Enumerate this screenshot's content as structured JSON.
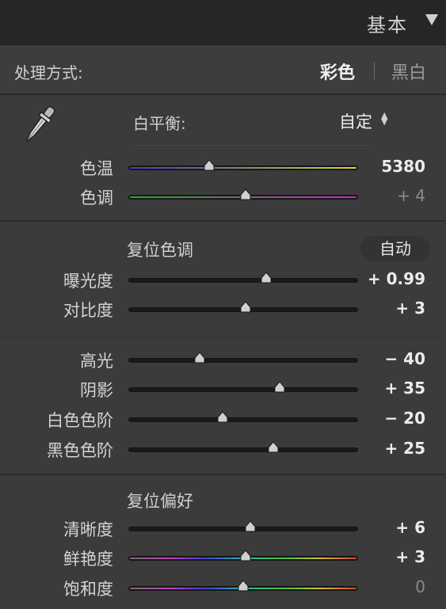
{
  "header": {
    "title": "基本"
  },
  "treatment": {
    "label": "处理方式:",
    "color": "彩色",
    "bw": "黑白"
  },
  "white_balance": {
    "label": "白平衡:",
    "value": "自定"
  },
  "tone": {
    "reset_label": "复位色调",
    "auto_label": "自动"
  },
  "presence": {
    "reset_label": "复位偏好"
  },
  "sliders": {
    "temp": {
      "label": "色温",
      "value": "5380",
      "level": 0.35
    },
    "tint": {
      "label": "色调",
      "value": "+ 4",
      "level": 0.51
    },
    "exposure": {
      "label": "曝光度",
      "value": "+ 0.99",
      "level": 0.6
    },
    "contrast": {
      "label": "对比度",
      "value": "+ 3",
      "level": 0.51
    },
    "highlights": {
      "label": "高光",
      "value": "− 40",
      "level": 0.31
    },
    "shadows": {
      "label": "阴影",
      "value": "+ 35",
      "level": 0.66
    },
    "whites": {
      "label": "白色色阶",
      "value": "− 20",
      "level": 0.41
    },
    "blacks": {
      "label": "黑色色阶",
      "value": "+ 25",
      "level": 0.63
    },
    "clarity": {
      "label": "清晰度",
      "value": "+ 6",
      "level": 0.53
    },
    "vibrance": {
      "label": "鲜艳度",
      "value": "+ 3",
      "level": 0.51
    },
    "saturation": {
      "label": "饱和度",
      "value": "0",
      "level": 0.5
    }
  },
  "colors": {
    "temp_gradient": [
      "#3a3ad0",
      "#d8d820"
    ],
    "tint_gradient": [
      "#20b020",
      "#d020d0"
    ],
    "vib_gradient": [
      "#8a8a8a",
      "#d04040"
    ]
  },
  "icons": {
    "eyedropper": "eyedropper-icon",
    "panel_toggle": "triangle-down-icon",
    "wb_stepper": "up-down-arrows-icon"
  }
}
